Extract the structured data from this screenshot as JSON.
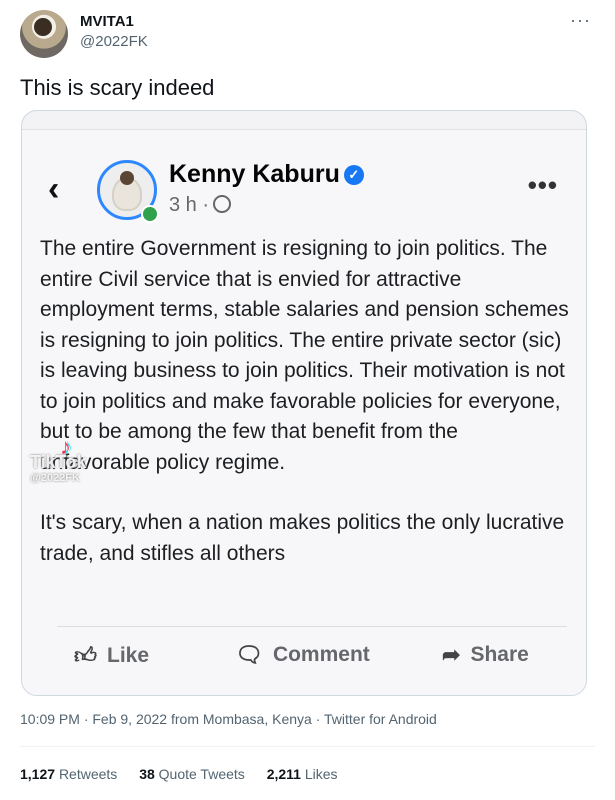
{
  "tweet": {
    "display_name": "MVITA1",
    "handle": "@2022FK",
    "more_icon": "···",
    "text": "This is scary indeed",
    "timestamp": "10:09 PM · Feb 9, 2022 from Mombasa, Kenya · Twitter for Android",
    "stats": {
      "retweets_count": "1,127",
      "retweets_label": "Retweets",
      "quotes_count": "38",
      "quotes_label": "Quote Tweets",
      "likes_count": "2,211",
      "likes_label": "Likes"
    }
  },
  "embedded_post": {
    "back_icon": "‹",
    "author": "Kenny Kaburu",
    "verified_icon": "✓",
    "time": "3 h ·",
    "more_icon": "•••",
    "paragraph_1": "The entire Government is resigning to join politics. The entire Civil service that is envied for attractive employment terms, stable salaries and pension schemes is resigning to join politics. The entire private sector (sic) is leaving business to join politics. Their motivation is not to join politics and make favorable policies for everyone, but to be among the few that benefit from the unfavorable policy regime.",
    "paragraph_2": "It's scary, when a nation makes politics the only lucrative trade, and stifles all others",
    "actions": {
      "like": "Like",
      "comment": "Comment",
      "share": "Share"
    },
    "watermark": {
      "brand": "TikTok",
      "user": "@2022FK"
    }
  },
  "icons": {
    "like": "thumbs-up-icon",
    "comment": "comment-bubble-icon",
    "share": "share-arrow-icon",
    "globe": "globe-icon"
  },
  "colors": {
    "verified": "#1877f2",
    "online": "#31a24c",
    "secondary_text": "#536471"
  }
}
